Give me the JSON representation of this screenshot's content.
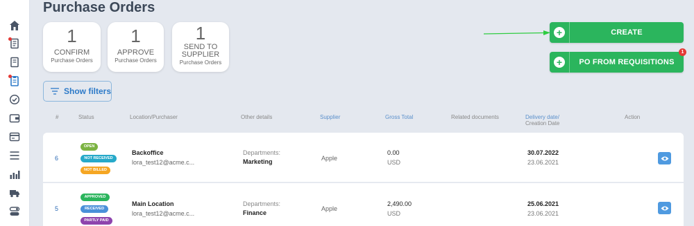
{
  "page": {
    "title": "Purchase Orders"
  },
  "sidebar": {
    "items": [
      {
        "icon": "home-icon"
      },
      {
        "icon": "document-icon",
        "dot": true
      },
      {
        "icon": "document-icon",
        "dot": false
      },
      {
        "icon": "clipboard-icon",
        "dot": true
      },
      {
        "icon": "check-circle-icon"
      },
      {
        "icon": "wallet-icon"
      },
      {
        "icon": "card-icon"
      },
      {
        "icon": "menu-icon"
      },
      {
        "icon": "bar-chart-icon"
      },
      {
        "icon": "truck-icon"
      },
      {
        "icon": "toggle-icon"
      }
    ]
  },
  "stats": [
    {
      "count": "1",
      "label": "CONFIRM",
      "sub": "Purchase Orders"
    },
    {
      "count": "1",
      "label": "APPROVE",
      "sub": "Purchase Orders"
    },
    {
      "count": "1",
      "label": "SEND TO SUPPLIER",
      "sub": "Purchase Orders"
    }
  ],
  "actions": {
    "create_label": "CREATE",
    "po_label": "PO FROM REQUISITIONS",
    "po_badge": "1"
  },
  "filters": {
    "label": "Show filters"
  },
  "table": {
    "headers": {
      "num": "#",
      "status": "Status",
      "location": "Location/Purchaser",
      "other": "Other details",
      "supplier": "Supplier",
      "gross": "Gross Total",
      "related": "Related documents",
      "delivery": "Delivery date/",
      "creation": "Creation Date",
      "action": "Action"
    },
    "rows": [
      {
        "num": "6",
        "statuses": [
          "OPEN",
          "NOT RECEIVED",
          "NOT BILLED"
        ],
        "location": "Backoffice",
        "purchaser": "lora_test12@acme.c...",
        "dept_label": "Departments:",
        "dept_value": "Marketing",
        "supplier": "Apple",
        "amount": "0.00",
        "currency": "USD",
        "delivery": "30.07.2022",
        "created": "23.06.2021"
      },
      {
        "num": "5",
        "statuses": [
          "APPROVED",
          "RECEIVED",
          "PARTLY PAID"
        ],
        "location": "Main Location",
        "purchaser": "lora_test12@acme.c...",
        "dept_label": "Departments:",
        "dept_value": "Finance",
        "supplier": "Apple",
        "amount": "2,490.00",
        "currency": "USD",
        "delivery": "25.06.2021",
        "created": "23.06.2021"
      }
    ]
  },
  "colors": {
    "green": "#2bb55d",
    "open": "#7cb342",
    "not_received": "#26a9c9",
    "not_billed": "#f5a623",
    "approved": "#2bb55d",
    "received": "#4a90d9",
    "partly_paid": "#8e44ad"
  }
}
